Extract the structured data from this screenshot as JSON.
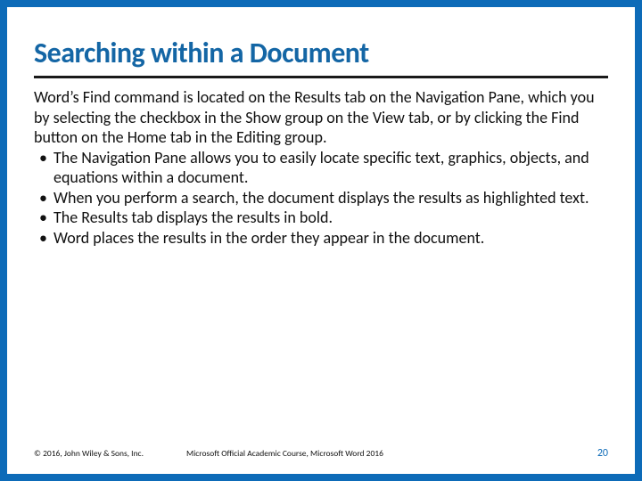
{
  "title": "Searching within a Document",
  "intro": "Word’s Find command is located on the Results tab on the Navigation Pane, which you by selecting the checkbox in the Show group on the View tab, or by clicking the Find button on the Home tab in the Editing group.",
  "bullets": [
    "The Navigation Pane allows you to easily locate specific text, graphics, objects, and equations within a document.",
    "When you perform a search, the document displays the results as highlighted text.",
    "The Results tab displays the results in bold.",
    "Word places the results in the order they appear in the document."
  ],
  "footer": {
    "copyright": "© 2016, John Wiley & Sons, Inc.",
    "course": "Microsoft Official Academic Course, Microsoft Word 2016",
    "page": "20"
  }
}
